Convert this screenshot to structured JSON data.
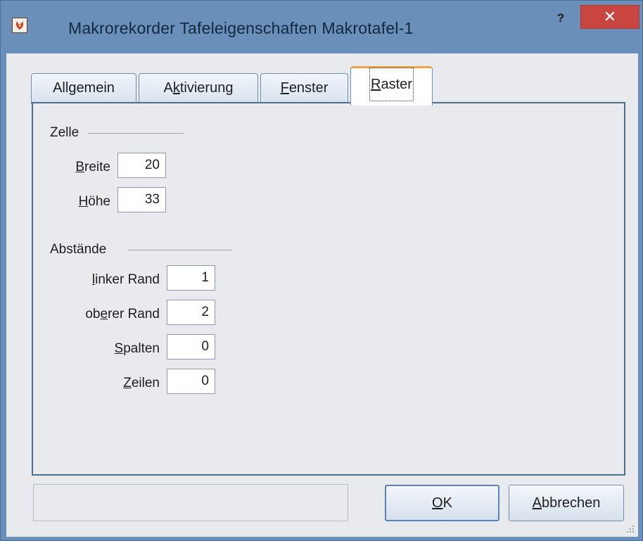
{
  "window": {
    "title": "Makrorekorder Tafeleigenschaften Makrotafel-1",
    "help_label": "?",
    "close_label": "✕"
  },
  "tabs": [
    {
      "label_pre": "All",
      "label_u": "g",
      "label_post": "emein",
      "active": false
    },
    {
      "label_pre": "A",
      "label_u": "k",
      "label_post": "tivierung",
      "active": false
    },
    {
      "label_pre": "",
      "label_u": "F",
      "label_post": "enster",
      "active": false
    },
    {
      "label_pre": "",
      "label_u": "R",
      "label_post": "aster",
      "active": true
    }
  ],
  "groups": {
    "zelle": {
      "title": "Zelle",
      "fields": [
        {
          "label_pre": "",
          "label_u": "B",
          "label_post": "reite",
          "value": "20"
        },
        {
          "label_pre": "",
          "label_u": "H",
          "label_post": "öhe",
          "value": "33"
        }
      ]
    },
    "abstaende": {
      "title": "Abstände",
      "fields": [
        {
          "label_pre": "",
          "label_u": "l",
          "label_post": "inker Rand",
          "value": "1"
        },
        {
          "label_pre": "ob",
          "label_u": "e",
          "label_post": "rer Rand",
          "value": "2"
        },
        {
          "label_pre": "",
          "label_u": "S",
          "label_post": "palten",
          "value": "0"
        },
        {
          "label_pre": "",
          "label_u": "Z",
          "label_post": "eilen",
          "value": "0"
        }
      ]
    }
  },
  "buttons": {
    "ok": {
      "label_pre": "",
      "label_u": "O",
      "label_post": "K"
    },
    "cancel": {
      "label_pre": "",
      "label_u": "A",
      "label_post": "bbrechen"
    }
  },
  "colors": {
    "frame": "#6a8fb8",
    "close": "#c8463f",
    "active_tab_accent": "#f2a14a",
    "panel_border": "#4b6d90"
  }
}
